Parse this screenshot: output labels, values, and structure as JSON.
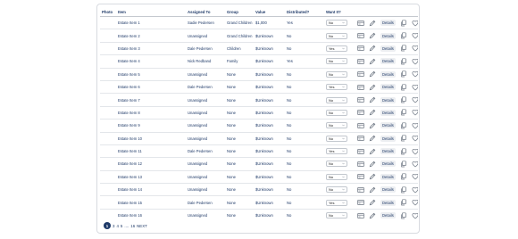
{
  "table": {
    "headers": {
      "photo": "Photo",
      "item": "Item",
      "assigned": "Assigned To",
      "group": "Group",
      "value": "Value",
      "distributed": "Distributed?",
      "want": "Want It?"
    },
    "rows": [
      {
        "item": "Estate Item 1",
        "assigned": "Sadie Pedersen",
        "group": "Grand Children",
        "value": "$1,000",
        "distributed": "Yes",
        "want": "No",
        "details": "Details"
      },
      {
        "item": "Estate Item 2",
        "assigned": "Unassigned",
        "group": "Grand Children",
        "value": "$Unknown",
        "distributed": "No",
        "want": "No",
        "details": "Details"
      },
      {
        "item": "Estate Item 3",
        "assigned": "Dale Pedersen",
        "group": "Children",
        "value": "$Unknown",
        "distributed": "No",
        "want": "Yes",
        "details": "Details"
      },
      {
        "item": "Estate Item 4",
        "assigned": "Nick Redband",
        "group": "Family",
        "value": "$Unknown",
        "distributed": "Yes",
        "want": "No",
        "details": "Details"
      },
      {
        "item": "Estate Item 5",
        "assigned": "Unassigned",
        "group": "None",
        "value": "$Unknown",
        "distributed": "No",
        "want": "No",
        "details": "Details"
      },
      {
        "item": "Estate Item 6",
        "assigned": "Dale Pedersen",
        "group": "None",
        "value": "$Unknown",
        "distributed": "No",
        "want": "Yes",
        "details": "Details"
      },
      {
        "item": "Estate Item 7",
        "assigned": "Unassigned",
        "group": "None",
        "value": "$Unknown",
        "distributed": "No",
        "want": "No",
        "details": "Details"
      },
      {
        "item": "Estate Item 8",
        "assigned": "Unassigned",
        "group": "None",
        "value": "$Unknown",
        "distributed": "No",
        "want": "No",
        "details": "Details"
      },
      {
        "item": "Estate Item 9",
        "assigned": "Unassigned",
        "group": "None",
        "value": "$Unknown",
        "distributed": "No",
        "want": "No",
        "details": "Details"
      },
      {
        "item": "Estate Item 10",
        "assigned": "Unassigned",
        "group": "None",
        "value": "$Unknown",
        "distributed": "No",
        "want": "No",
        "details": "Details"
      },
      {
        "item": "Estate Item 11",
        "assigned": "Dale Pedersen",
        "group": "None",
        "value": "$Unknown",
        "distributed": "No",
        "want": "Yes",
        "details": "Details"
      },
      {
        "item": "Estate Item 12",
        "assigned": "Unassigned",
        "group": "None",
        "value": "$Unknown",
        "distributed": "No",
        "want": "No",
        "details": "Details"
      },
      {
        "item": "Estate Item 13",
        "assigned": "Unassigned",
        "group": "None",
        "value": "$Unknown",
        "distributed": "No",
        "want": "No",
        "details": "Details"
      },
      {
        "item": "Estate Item 14",
        "assigned": "Unassigned",
        "group": "None",
        "value": "$Unknown",
        "distributed": "No",
        "want": "No",
        "details": "Details"
      },
      {
        "item": "Estate Item 15",
        "assigned": "Dale Pedersen",
        "group": "None",
        "value": "$Unknown",
        "distributed": "No",
        "want": "Yes",
        "details": "Details"
      },
      {
        "item": "Estate Item 16",
        "assigned": "Unassigned",
        "group": "None",
        "value": "$Unknown",
        "distributed": "No",
        "want": "No",
        "details": "Details"
      }
    ],
    "row_icons": [
      "card-icon",
      "pencil-icon",
      "copy-icon",
      "heart-icon"
    ]
  },
  "pagination": {
    "current": "1",
    "pages": [
      "3",
      "4",
      "5",
      "....",
      "16"
    ],
    "next": "NEXT"
  },
  "colors": {
    "text": "#1f3a68",
    "border": "#d8dbe0",
    "accent": "#1f3a68"
  }
}
